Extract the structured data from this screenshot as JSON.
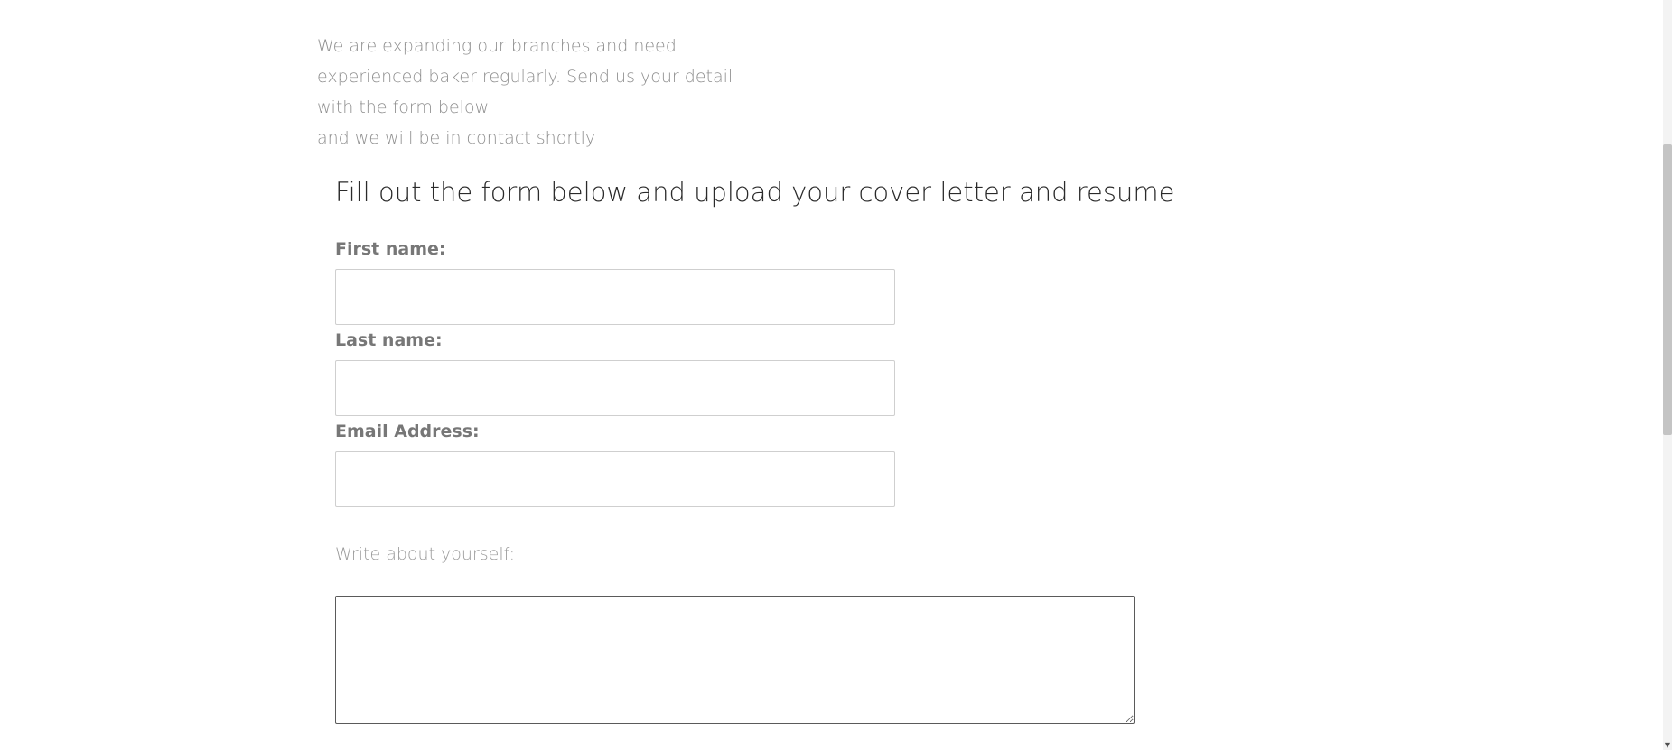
{
  "intro": {
    "lines": [
      "We are expanding our branches and need",
      "experienced baker regularly. Send us your detail",
      "with the form below",
      "and we will be in contact shortly"
    ]
  },
  "form": {
    "heading": "Fill out the form below and upload your cover letter and resume",
    "first_name": {
      "label": "First name:",
      "value": ""
    },
    "last_name": {
      "label": "Last name:",
      "value": ""
    },
    "email": {
      "label": "Email Address:",
      "value": ""
    },
    "about": {
      "label": "Write about yourself:",
      "value": ""
    }
  },
  "scrollbar": {
    "arrow_icon": "chevron-down-icon"
  }
}
